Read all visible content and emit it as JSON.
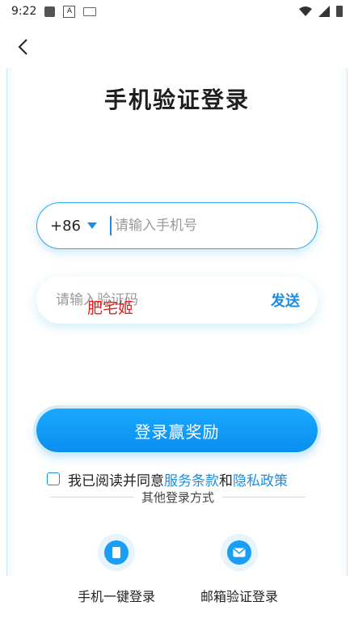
{
  "status_bar": {
    "time": "9:22",
    "icons": [
      "notification-square-icon",
      "a-badge-icon",
      "keyboard-icon",
      "wifi-icon",
      "signal-icon",
      "battery-icon"
    ]
  },
  "header": {
    "back_icon": "chevron-left-icon",
    "title": "手机验证登录"
  },
  "phone_field": {
    "country_code": "+86",
    "placeholder": "请输入手机号",
    "value": ""
  },
  "code_field": {
    "placeholder": "请输入验证码",
    "value": "",
    "send_label": "发送"
  },
  "watermark": "肥宅姬",
  "login_button": {
    "label": "登录赢奖励"
  },
  "agreement": {
    "prefix": "我已阅读并同意",
    "terms_link": "服务条款",
    "and": "和",
    "privacy_link": "隐私政策",
    "checked": false
  },
  "other_login": {
    "divider_label": "其他登录方式",
    "options": [
      {
        "label": "手机一键登录",
        "icon": "phone-icon"
      },
      {
        "label": "邮箱验证登录",
        "icon": "mail-icon"
      }
    ]
  },
  "colors": {
    "accent": "#1a8fe0",
    "button": "#0a9bf5",
    "watermark": "#e02020"
  }
}
